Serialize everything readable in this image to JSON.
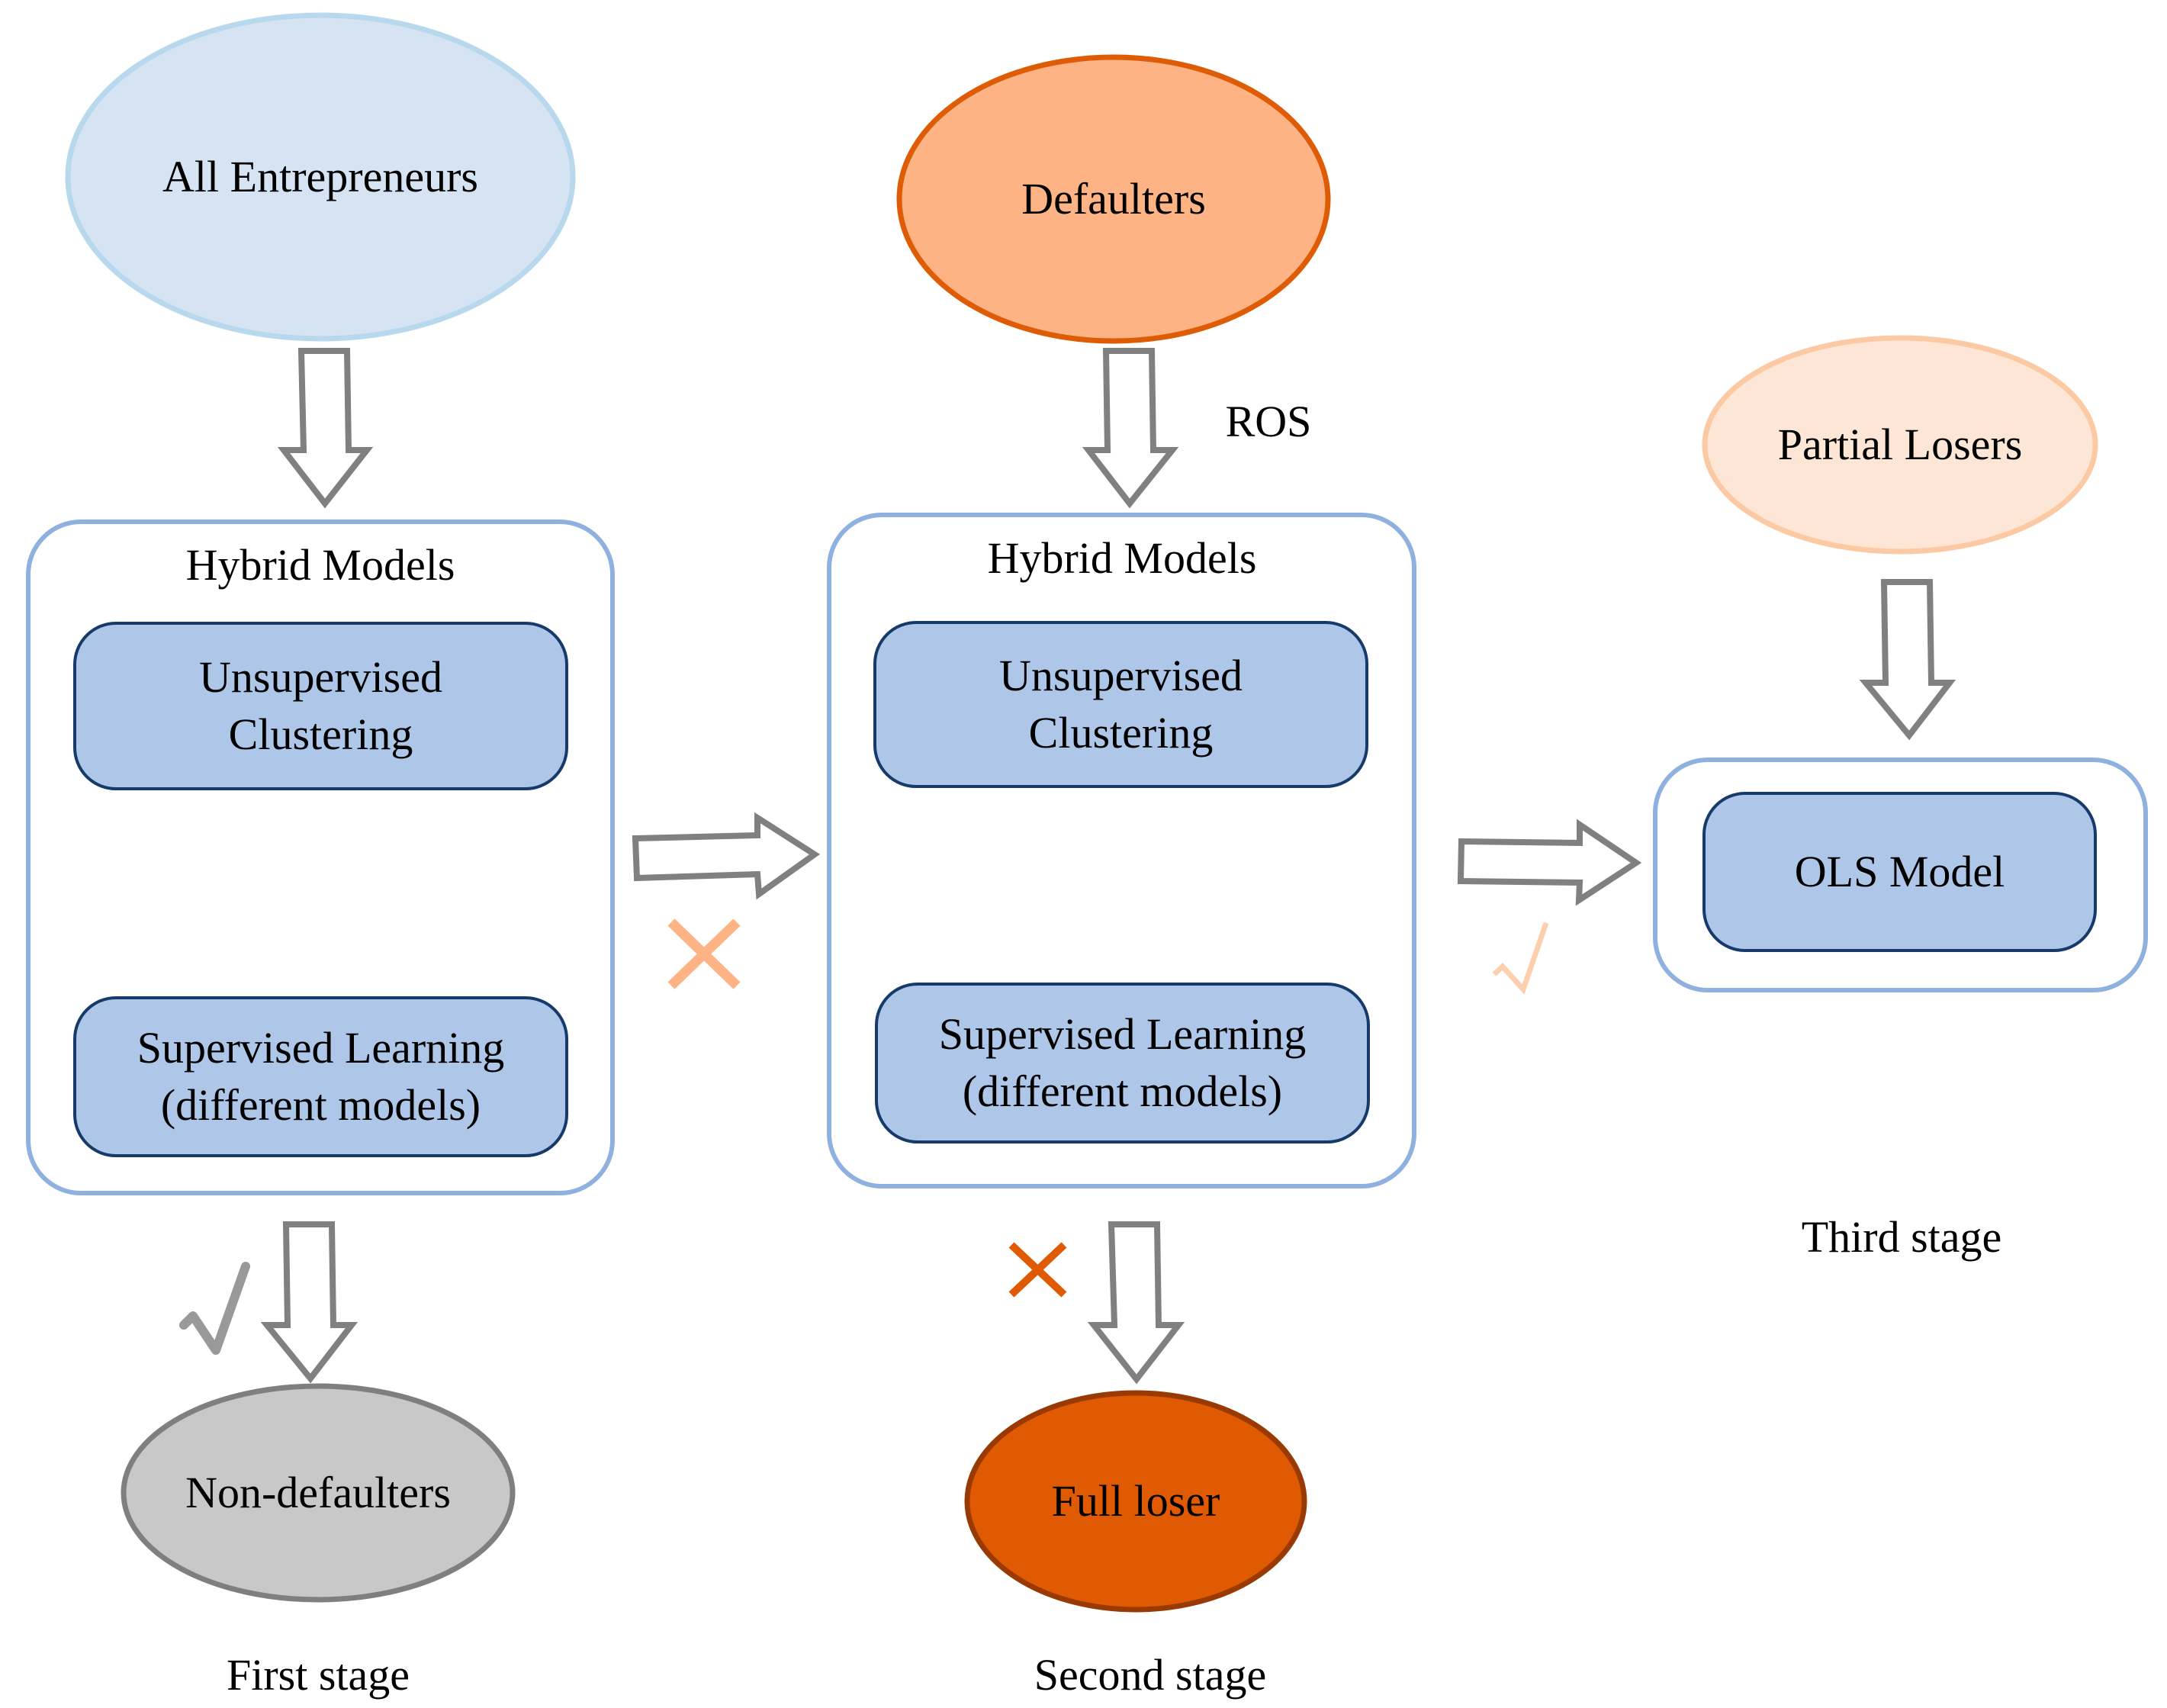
{
  "diagram": {
    "type": "flowchart",
    "colors": {
      "entrepreneurs_fill": "#d6e3f3",
      "entrepreneurs_stroke": "#b8d8ee",
      "defaulters_fill": "#fdb383",
      "defaulters_stroke": "#de5c05",
      "partial_losers_fill": "#fde6d5",
      "partial_losers_stroke": "#fbcaa5",
      "non_defaulters_fill": "#c8c8c8",
      "non_defaulters_stroke": "#7f7f7f",
      "full_loser_fill": "#df5a02",
      "full_loser_stroke": "#9a3a03",
      "container_stroke": "#8eb1df",
      "inner_box_fill": "#aec7e8",
      "inner_box_stroke": "#163b6a",
      "arrow_stroke": "#808080",
      "cross_light": "#fdb383",
      "cross_dark": "#df5a02",
      "check_light": "#fdcfaf",
      "check_grey": "#999999"
    },
    "nodes": {
      "all_entrepreneurs": "All Entrepreneurs",
      "defaulters": "Defaulters",
      "partial_losers": "Partial Losers",
      "non_defaulters": "Non-defaulters",
      "full_loser": "Full loser"
    },
    "stage1": {
      "container_title": "Hybrid Models",
      "step1": "Unsupervised Clustering",
      "step1_line1": "Unsupervised",
      "step1_line2": "Clustering",
      "step2_line1": "Supervised Learning",
      "step2_line2": "(different models)",
      "label": "First stage",
      "exit_mark": "check",
      "next_mark": "cross"
    },
    "stage2": {
      "input_annotation": "ROS",
      "container_title": "Hybrid Models",
      "step1_line1": "Unsupervised",
      "step1_line2": "Clustering",
      "step2_line1": "Supervised Learning",
      "step2_line2": "(different models)",
      "label": "Second stage",
      "exit_mark": "cross",
      "next_mark": "check"
    },
    "stage3": {
      "model": "OLS Model",
      "label": "Third stage"
    },
    "marks": {
      "check_symbol": "✓",
      "cross_symbol": "✕"
    }
  }
}
